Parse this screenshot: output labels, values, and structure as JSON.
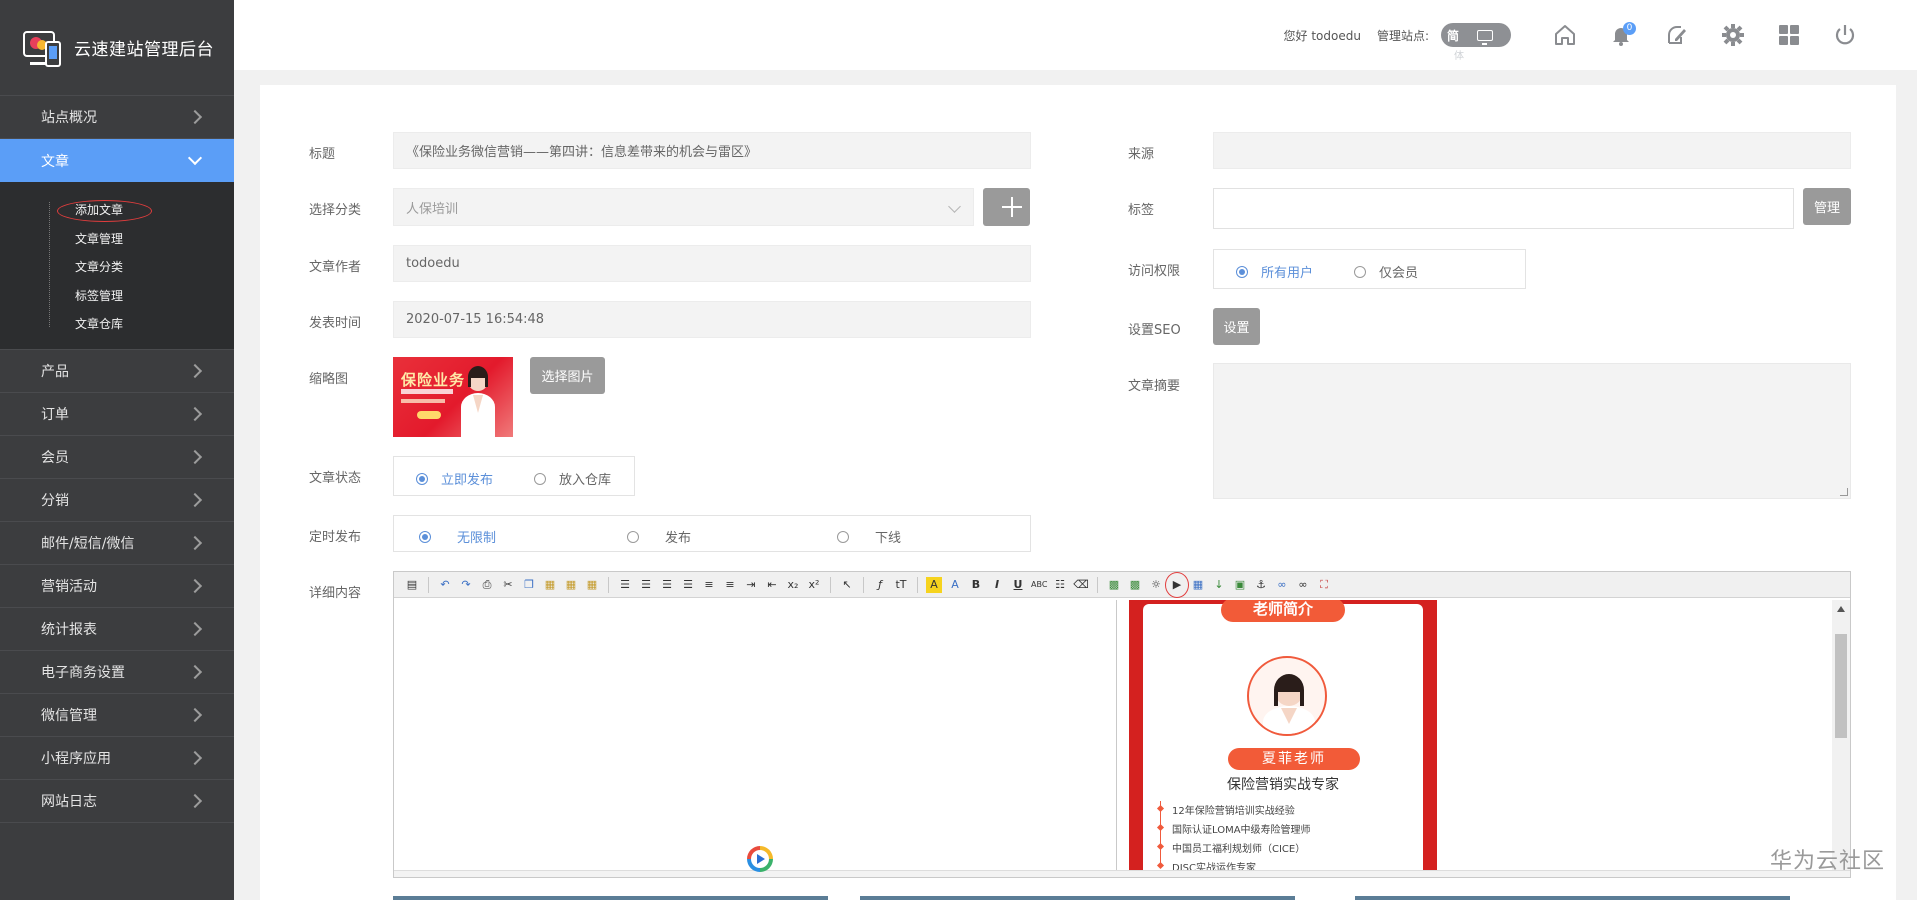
{
  "app": {
    "title": "云速建站管理后台"
  },
  "header": {
    "greeting": "您好 todoedu",
    "site_label": "管理站点:",
    "site_lang": "简",
    "site_lang_tail": "体",
    "notification_count": "0"
  },
  "sidebar": {
    "items": [
      {
        "label": "站点概况"
      },
      {
        "label": "文章"
      },
      {
        "label": "产品"
      },
      {
        "label": "订单"
      },
      {
        "label": "会员"
      },
      {
        "label": "分销"
      },
      {
        "label": "邮件/短信/微信"
      },
      {
        "label": "营销活动"
      },
      {
        "label": "统计报表"
      },
      {
        "label": "电子商务设置"
      },
      {
        "label": "微信管理"
      },
      {
        "label": "小程序应用"
      },
      {
        "label": "网站日志"
      }
    ],
    "sub_items": [
      {
        "label": "添加文章"
      },
      {
        "label": "文章管理"
      },
      {
        "label": "文章分类"
      },
      {
        "label": "标签管理"
      },
      {
        "label": "文章仓库"
      }
    ]
  },
  "form": {
    "title_label": "标题",
    "title_value": "《保险业务微信营销——第四讲：信息差带来的机会与雷区》",
    "category_label": "选择分类",
    "category_value": "人保培训",
    "author_label": "文章作者",
    "author_value": "todoedu",
    "publish_time_label": "发表时间",
    "publish_time_value": "2020-07-15 16:54:48",
    "thumbnail_label": "缩略图",
    "choose_image_button": "选择图片",
    "thumb_text": "保险业务",
    "status_label": "文章状态",
    "status_options": [
      "立即发布",
      "放入仓库"
    ],
    "schedule_label": "定时发布",
    "schedule_options": [
      "无限制",
      "发布",
      "下线"
    ],
    "content_label": "详细内容",
    "source_label": "来源",
    "source_value": "",
    "tags_label": "标签",
    "tags_value": "",
    "manage_button": "管理",
    "access_label": "访问权限",
    "access_options": [
      "所有用户",
      "仅会员"
    ],
    "seo_label": "设置SEO",
    "seo_button": "设置",
    "summary_label": "文章摘要",
    "summary_value": ""
  },
  "editor_preview": {
    "ribbon": "老师简介",
    "teacher_name": "夏菲老师",
    "teacher_title": "保险营销实战专家",
    "credentials": [
      "12年保险营销培训实战经验",
      "国际认证LOMA中级寿险管理师",
      "中国员工福利规划师（CICE）",
      "DISC实战运作专家"
    ]
  },
  "watermark": "华为云社区",
  "colors": {
    "sidebar_bg": "#3c3d3f",
    "accent": "#5b9ef7",
    "poster_red": "#d4211f",
    "button_gray": "#9a9a9a"
  }
}
